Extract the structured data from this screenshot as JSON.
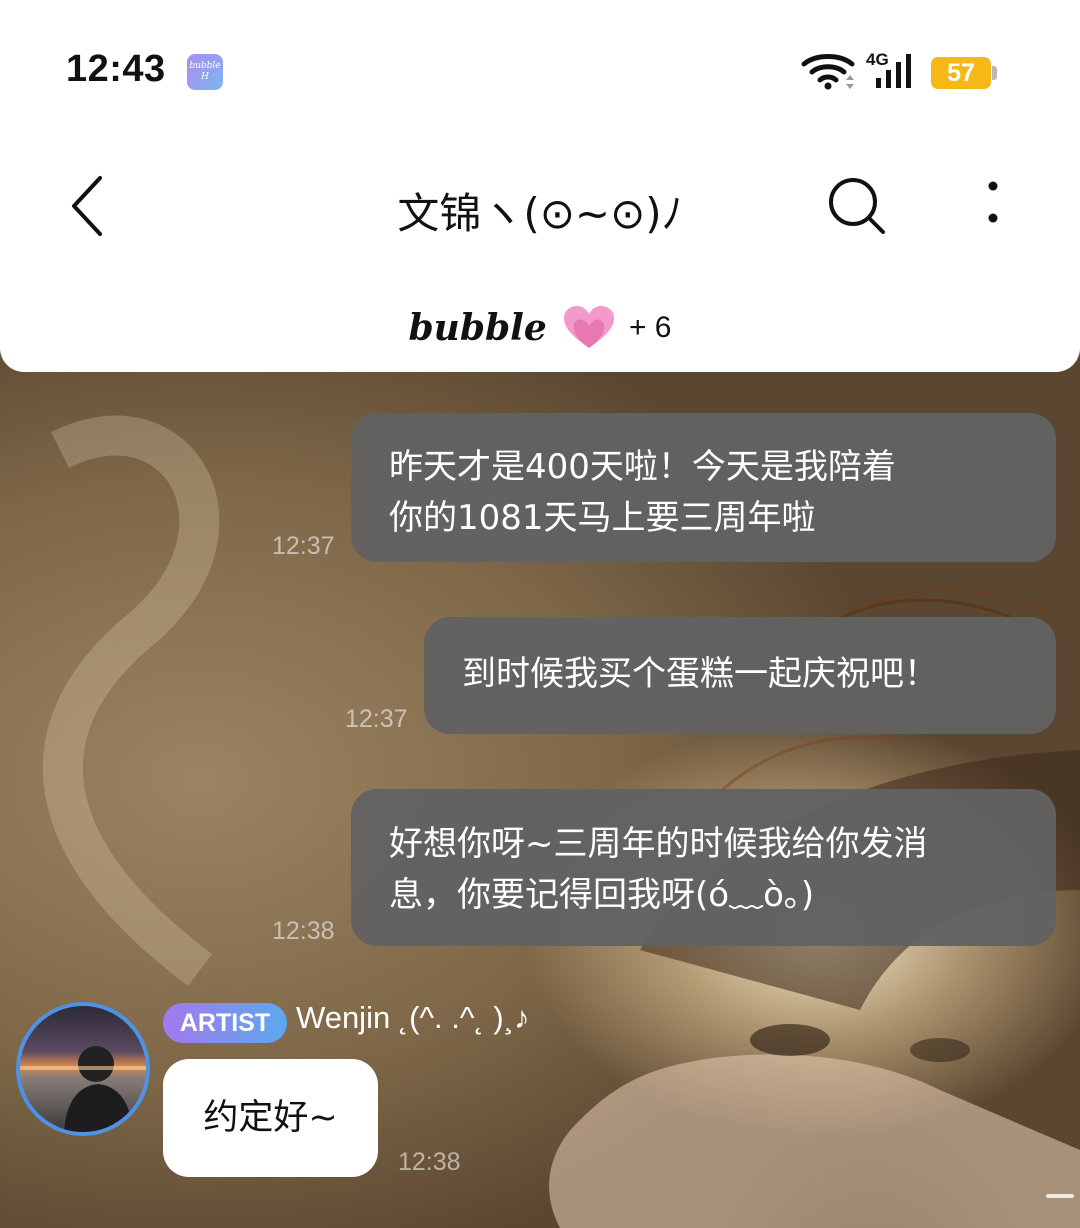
{
  "status_bar": {
    "time": "12:43",
    "app_badge_text": "bubble",
    "app_badge_sub": "H",
    "network": "4G",
    "battery": "57"
  },
  "header": {
    "title": "文锦ヽ(⊙~⊙)ﾉ",
    "brand": "bubble",
    "member_count": "+ 6"
  },
  "messages": [
    {
      "text_line1": "昨天才是400天啦！今天是我陪着",
      "text_line2": "你的1081天马上要三周年啦",
      "time": "12:37"
    },
    {
      "text_line1": "到时候我买个蛋糕一起庆祝吧！",
      "time": "12:37"
    },
    {
      "text_line1": "好想你呀~三周年的时候我给你发消",
      "text_line2": "息，你要记得回我呀(ó﹏ò｡)",
      "time": "12:38"
    }
  ],
  "artist_message": {
    "badge": "ARTIST",
    "name": "Wenjin ˛(^. .^˛ )¸♪",
    "text": "约定好~",
    "time": "12:38"
  },
  "icons": {
    "back": "chevron-left-icon",
    "search": "search-icon",
    "more": "more-vertical-icon",
    "heart": "heart-icon",
    "wifi": "wifi-icon",
    "signal": "signal-icon"
  },
  "colors": {
    "bubble_gray": "#626262",
    "artist_badge_start": "#a479ef",
    "artist_badge_end": "#5aa9ee",
    "battery": "#f6b815",
    "heart": "#f08ac0"
  }
}
